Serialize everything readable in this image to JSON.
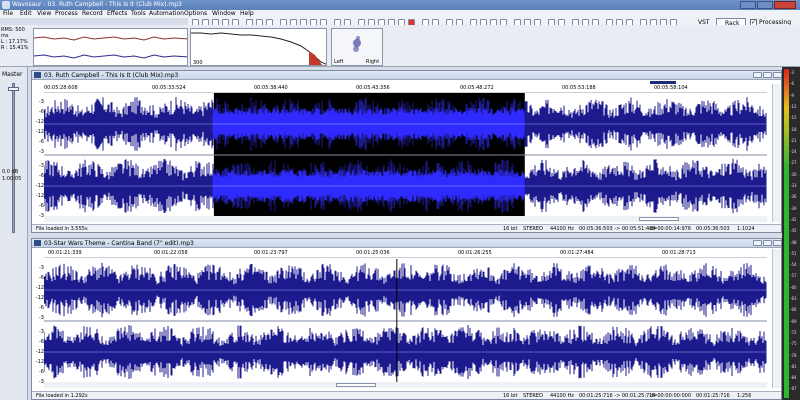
{
  "app": {
    "title": "Wavosaur - 03. Ruth Campbell - This Is It (Club Mix).mp3"
  },
  "menu": [
    "File",
    "Edit",
    "View",
    "Process",
    "Record",
    "Effects",
    "Tools",
    "Automation",
    "Options",
    "Window",
    "Help"
  ],
  "toolbar": {
    "vst_label": "VST",
    "rack_label": "Rack",
    "processing_label": "Processing",
    "processing_checked": true
  },
  "info": {
    "rms": "RMS: 500 ms",
    "left": "L : 17.17%",
    "right": "R : 15.41%"
  },
  "spectrum_label": "300",
  "vectorscope": {
    "left": "Left",
    "right": "Right"
  },
  "master": {
    "label": "Master",
    "db": "0.0 dB",
    "time": "1:00:05"
  },
  "windows": [
    {
      "title": "03. Ruth Campbell - This Is It (Club Mix).mp3",
      "ticks": [
        "00:05:28:608",
        "00:05:33:524",
        "00:05:38:440",
        "00:05:43:356",
        "00:05:48:272",
        "00:05:53:188",
        "00:05:58:104"
      ],
      "scale_top": [
        "-3",
        "-6",
        "-12",
        "-12",
        "-6",
        "-3"
      ],
      "scale_bottom": [
        "-3",
        "-6",
        "-12",
        "-12",
        "-6",
        "-3"
      ],
      "status": {
        "loaded": "File loaded in 3.555s",
        "bits": "16 bit",
        "mode": "STEREO",
        "rate": "44100 Hz",
        "range": "00:05:36:503 -> 00:05:51:489",
        "delta": "d=00:00:14:976",
        "pos": "00:05:36:503",
        "zoom": "1:1024"
      },
      "selection": {
        "start": 0.235,
        "end": 0.665
      }
    },
    {
      "title": "03-Star Wars Theme - Cantina Band (7\" edit).mp3",
      "ticks": [
        "00:01:21:339",
        "00:01:22:058",
        "00:01:23:797",
        "00:01:25:036",
        "00:01:26:255",
        "00:01:27:484",
        "00:01:28:713"
      ],
      "scale_top": [
        "-3",
        "-6",
        "-12",
        "-12",
        "-6",
        "-3"
      ],
      "scale_bottom": [
        "-3",
        "-6",
        "-12",
        "-12",
        "-6",
        "-3"
      ],
      "status": {
        "loaded": "File loaded in 1.292s",
        "bits": "16 bit",
        "mode": "STEREO",
        "rate": "44100 Hz",
        "range": "00:01:25:716 -> 00:01:25:716",
        "delta": "d=00:00:00:000",
        "pos": "00:01:25:716",
        "zoom": "1:256"
      },
      "cursor": 0.488
    }
  ],
  "meter_scale": [
    "-3",
    "-6",
    "-9",
    "-12",
    "-15",
    "-18",
    "-21",
    "-24",
    "-27",
    "-30",
    "-33",
    "-36",
    "-39",
    "-42",
    "-45",
    "-48",
    "-51",
    "-54",
    "-57",
    "-60",
    "-63",
    "-66",
    "-69",
    "-72",
    "-75",
    "-78",
    "-81",
    "-84",
    "-87"
  ],
  "colors": {
    "wave": "#1c1a8c",
    "wave_selected": "#2f2bff",
    "selection_bg": "#000000",
    "title_blue": "#5a80bb"
  }
}
